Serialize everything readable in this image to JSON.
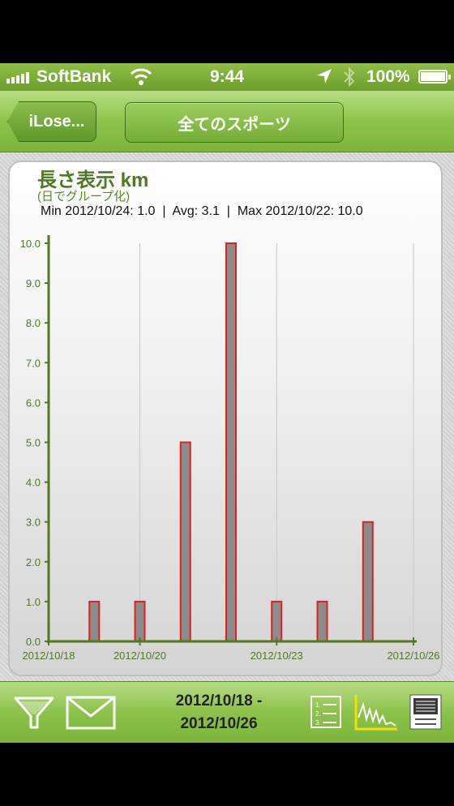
{
  "status_bar": {
    "carrier": "SoftBank",
    "time": "9:44",
    "battery": "100%",
    "icons": [
      "signal-icon",
      "wifi-icon",
      "location-icon",
      "bluetooth-icon",
      "battery-icon"
    ]
  },
  "nav": {
    "back_label": "iLose...",
    "title_button": "全てのスポーツ"
  },
  "chart": {
    "title": "長さ表示 km",
    "subtitle": "(日でグループ化)",
    "stats": "Min 2012/10/24: 1.0  |  Avg: 3.1  |  Max 2012/10/22: 10.0"
  },
  "chart_data": {
    "type": "bar",
    "title": "長さ表示 km",
    "subtitle": "(日でグループ化)",
    "x": [
      "2012/10/19",
      "2012/10/20",
      "2012/10/21",
      "2012/10/22",
      "2012/10/23",
      "2012/10/24",
      "2012/10/25"
    ],
    "values": [
      1.0,
      1.0,
      5.0,
      10.0,
      1.0,
      1.0,
      3.0
    ],
    "x_tick_labels": [
      "2012/10/18",
      "2012/10/20",
      "2012/10/23",
      "2012/10/26"
    ],
    "y_tick_labels": [
      "0.0",
      "1.0",
      "2.0",
      "3.0",
      "4.0",
      "5.0",
      "6.0",
      "7.0",
      "8.0",
      "9.0",
      "10.0"
    ],
    "ylim": [
      0,
      10
    ],
    "grid": true,
    "colors": {
      "bar_fill": "#8c8c8c",
      "bar_stroke": "#e02020",
      "axis": "#4f7a1f"
    }
  },
  "toolbar": {
    "date_from": "2012/10/18 -",
    "date_to": "2012/10/26",
    "icons": [
      "filter-icon",
      "mail-icon",
      "list-view-icon",
      "graph-view-icon",
      "detail-view-icon"
    ]
  }
}
